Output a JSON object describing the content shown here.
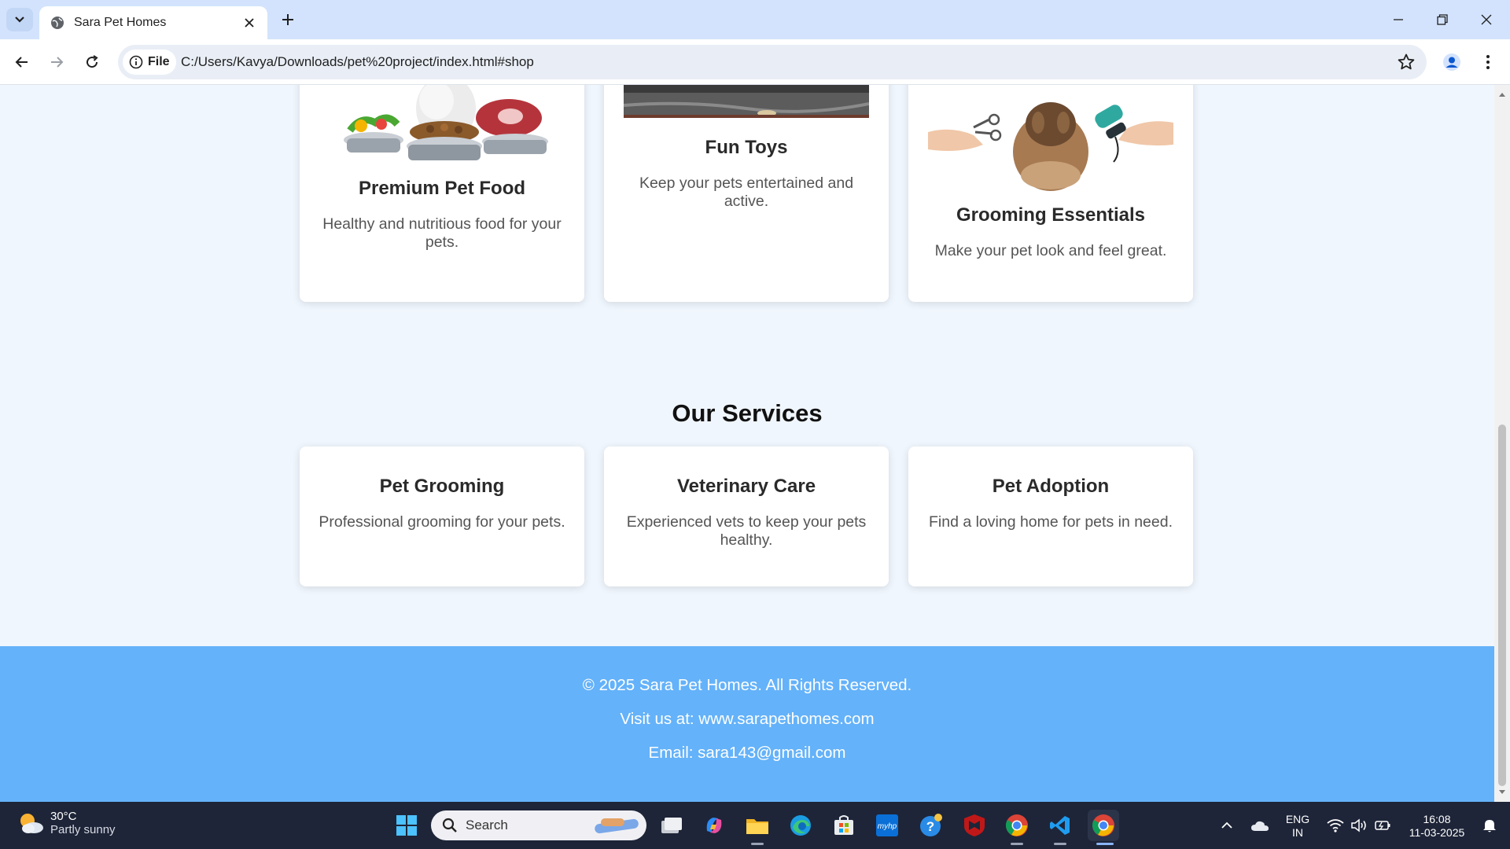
{
  "browser": {
    "tab_title": "Sara Pet Homes",
    "address_chip": "File",
    "url": "C:/Users/Kavya/Downloads/pet%20project/index.html#shop"
  },
  "shop": {
    "cards": [
      {
        "title": "Premium Pet Food",
        "desc": "Healthy and nutritious food for your pets."
      },
      {
        "title": "Fun Toys",
        "desc": "Keep your pets entertained and active."
      },
      {
        "title": "Grooming Essentials",
        "desc": "Make your pet look and feel great."
      }
    ]
  },
  "services": {
    "heading": "Our Services",
    "cards": [
      {
        "title": "Pet Grooming",
        "desc": "Professional grooming for your pets."
      },
      {
        "title": "Veterinary Care",
        "desc": "Experienced vets to keep your pets healthy."
      },
      {
        "title": "Pet Adoption",
        "desc": "Find a loving home for pets in need."
      }
    ]
  },
  "footer": {
    "copyright": "© 2025 Sara Pet Homes. All Rights Reserved.",
    "visit": "Visit us at: www.sarapethomes.com",
    "email": "Email: sara143@gmail.com"
  },
  "taskbar": {
    "weather_temp": "30°C",
    "weather_condition": "Partly sunny",
    "search_placeholder": "Search",
    "lang_top": "ENG",
    "lang_bottom": "IN",
    "time": "16:08",
    "date": "11-03-2025"
  }
}
